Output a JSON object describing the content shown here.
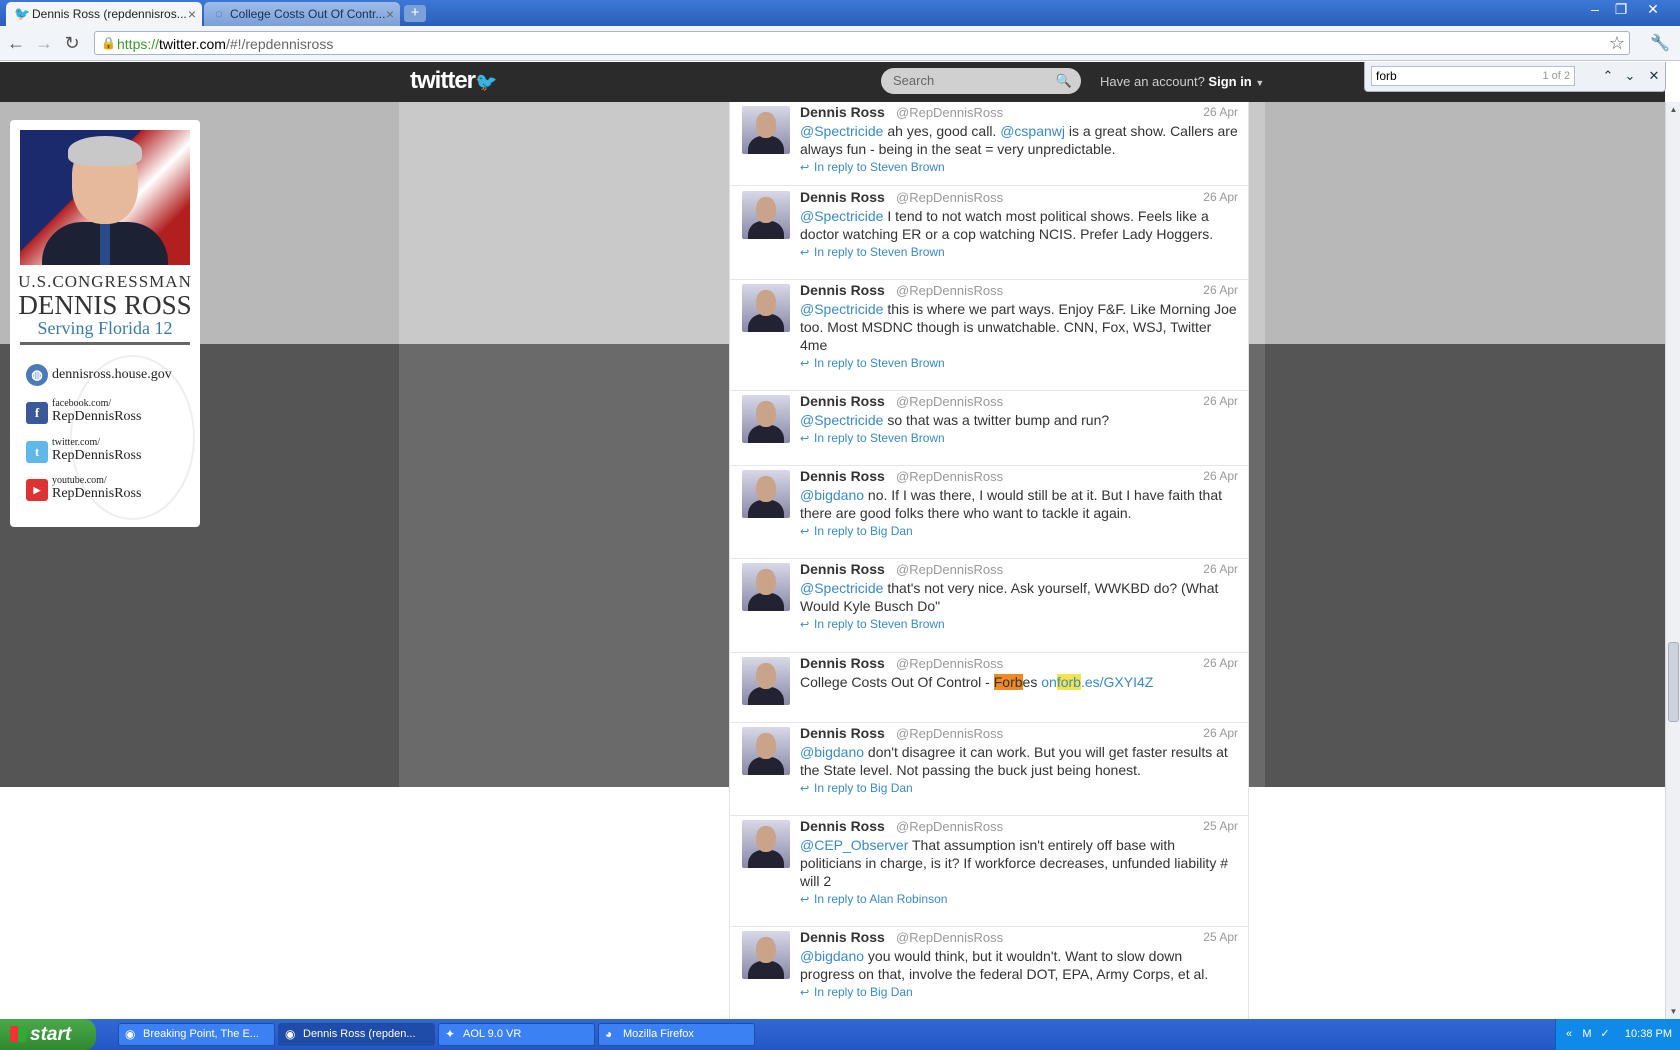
{
  "browser": {
    "tabs": [
      {
        "label": "Dennis Ross (repdennisros...",
        "icon": "twitter-bird-icon"
      },
      {
        "label": "College Costs Out Of Contr...",
        "icon": "loading-spinner-icon"
      }
    ],
    "url_scheme": "https://",
    "url_host": "twitter.com",
    "url_path": "/#!/repdennisross",
    "find": {
      "query": "forb",
      "count": "1 of 2"
    }
  },
  "twitter": {
    "logo": "twitter",
    "search_placeholder": "Search",
    "account_prompt": "Have an account?",
    "sign_in": "Sign in"
  },
  "profile": {
    "line1": "U.S.CONGRESSMAN",
    "line2": "DENNIS ROSS",
    "line3": "Serving Florida 12",
    "links": [
      {
        "prefix": "",
        "text": "dennisross.house.gov",
        "icon": "globe-icon"
      },
      {
        "prefix": "facebook.com/",
        "text": "RepDennisRoss",
        "icon": "facebook-icon"
      },
      {
        "prefix": "twitter.com/",
        "text": "RepDennisRoss",
        "icon": "twitter-icon"
      },
      {
        "prefix": "youtube.com/",
        "text": "RepDennisRoss",
        "icon": "youtube-icon"
      }
    ]
  },
  "tweets": [
    {
      "name": "Dennis Ross",
      "handle": "@RepDennisRoss",
      "date": "26 Apr",
      "mention": "@Spectricide",
      "text": " ah yes, good call. ",
      "mention2": "@cspanwj",
      "text2": " is a great show. Callers are always fun - being in the seat = very unpredictable.",
      "reply": "In reply to Steven Brown"
    },
    {
      "name": "Dennis Ross",
      "handle": "@RepDennisRoss",
      "date": "26 Apr",
      "mention": "@Spectricide",
      "text": " I tend to not watch most political shows. Feels like a doctor watching ER or a cop watching NCIS. Prefer Lady Hoggers.",
      "reply": "In reply to Steven Brown"
    },
    {
      "name": "Dennis Ross",
      "handle": "@RepDennisRoss",
      "date": "26 Apr",
      "mention": "@Spectricide",
      "text": " this is where we part ways. Enjoy F&F. Like Morning Joe too. Most MSDNC though is unwatchable. CNN, Fox, WSJ, Twitter 4me",
      "reply": "In reply to Steven Brown"
    },
    {
      "name": "Dennis Ross",
      "handle": "@RepDennisRoss",
      "date": "26 Apr",
      "mention": "@Spectricide",
      "text": " so that was a twitter bump and run?",
      "reply": "In reply to Steven Brown"
    },
    {
      "name": "Dennis Ross",
      "handle": "@RepDennisRoss",
      "date": "26 Apr",
      "mention": "@bigdano",
      "text": " no. If I was there, I would still be at it. But I have faith that there are good folks there who want to tackle it again.",
      "reply": "In reply to Big Dan"
    },
    {
      "name": "Dennis Ross",
      "handle": "@RepDennisRoss",
      "date": "26 Apr",
      "mention": "@Spectricide",
      "text": " that's not very nice. Ask yourself, WWKBD do? (What Would Kyle Busch Do\"",
      "reply": "In reply to Steven Brown"
    },
    {
      "name": "Dennis Ross",
      "handle": "@RepDennisRoss",
      "date": "26 Apr",
      "text_a": "College Costs Out Of Control - ",
      "hl": "Forb",
      "text_b": "es ",
      "link_a": "on",
      "hl2": "forb",
      "link_b": ".es/GXYI4Z"
    },
    {
      "name": "Dennis Ross",
      "handle": "@RepDennisRoss",
      "date": "26 Apr",
      "mention": "@bigdano",
      "text": " don't disagree it can work. But you will get faster results at the State level. Not passing the buck just being honest.",
      "reply": "In reply to Big Dan"
    },
    {
      "name": "Dennis Ross",
      "handle": "@RepDennisRoss",
      "date": "25 Apr",
      "mention": "@CEP_Observer",
      "text": " That assumption isn't entirely off base with politicians in charge, is it? If workforce decreases, unfunded liability # will 2",
      "reply": "In reply to Alan Robinson"
    },
    {
      "name": "Dennis Ross",
      "handle": "@RepDennisRoss",
      "date": "25 Apr",
      "mention": "@bigdano",
      "text": " you would think, but it wouldn't. Want to slow down progress on that, involve the federal DOT, EPA, Army Corps, et al.",
      "reply": "In reply to Big Dan"
    }
  ],
  "taskbar": {
    "start": "start",
    "items": [
      {
        "label": "Breaking Point, The E...",
        "icon": "chrome-icon"
      },
      {
        "label": "Dennis Ross (repden...",
        "icon": "chrome-icon"
      },
      {
        "label": "AOL 9.0 VR",
        "icon": "aol-icon"
      },
      {
        "label": "Mozilla Firefox",
        "icon": "firefox-icon"
      }
    ],
    "clock": "10:38 PM"
  }
}
